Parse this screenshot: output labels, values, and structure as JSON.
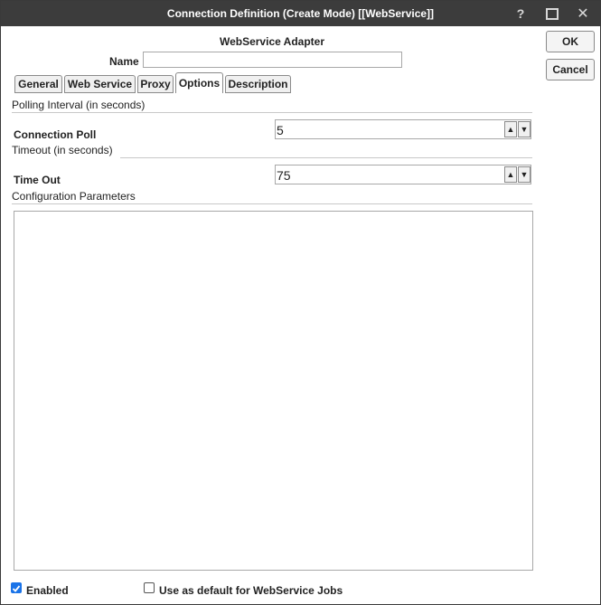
{
  "window": {
    "title": "Connection Definition (Create Mode) [[WebService]]",
    "help_glyph": "?",
    "close_glyph": "✕"
  },
  "header": {
    "adapter_title": "WebService Adapter",
    "name_label": "Name",
    "name_value": ""
  },
  "actions": {
    "ok_label": "OK",
    "cancel_label": "Cancel"
  },
  "tabs": [
    {
      "label": "General",
      "active": false
    },
    {
      "label": "Web Service",
      "active": false
    },
    {
      "label": "Proxy",
      "active": false
    },
    {
      "label": "Options",
      "active": true
    },
    {
      "label": "Description",
      "active": false
    }
  ],
  "options": {
    "polling_caption": "Polling Interval (in seconds)",
    "connection_poll_label": "Connection Poll",
    "connection_poll_value": "5",
    "timeout_caption": "Timeout (in seconds)",
    "time_out_label": "Time Out",
    "time_out_value": "75",
    "config_caption": "Configuration Parameters",
    "config_value": "",
    "spin_up_glyph": "▲",
    "spin_down_glyph": "▼"
  },
  "footer": {
    "enabled_label": "Enabled",
    "enabled_checked": true,
    "default_label": "Use as default for WebService Jobs",
    "default_checked": false
  },
  "colors": {
    "titlebar": "#3c3c3c",
    "checkbox_accent": "#1a73e8"
  }
}
